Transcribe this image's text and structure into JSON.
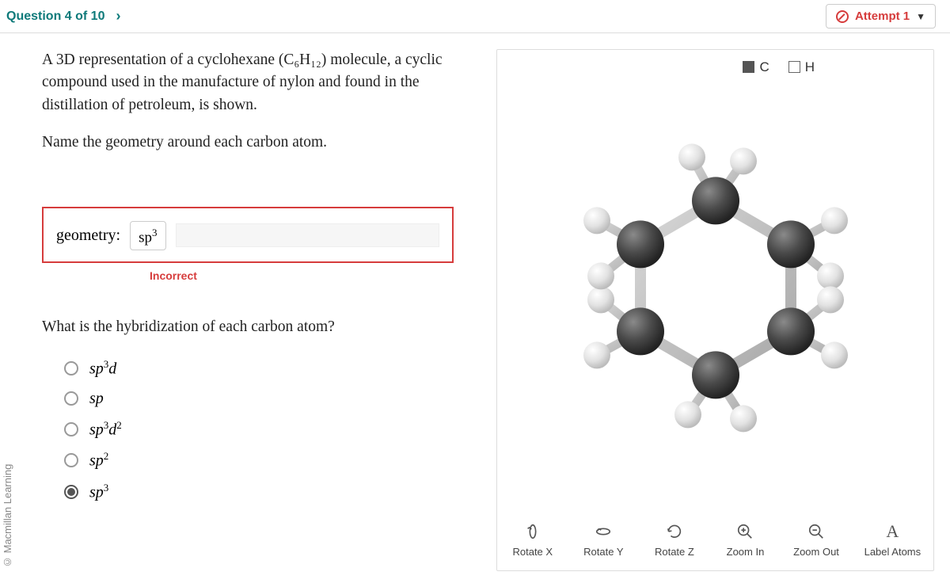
{
  "header": {
    "question_label": "Question 4 of 10",
    "attempt_label": "Attempt 1"
  },
  "watermark": "© Macmillan Learning",
  "prompt_text": "A 3D representation of a cyclohexane (C₆H₁₂) molecule, a cyclic compound used in the manufacture of nylon and found in the distillation of petroleum, is shown.",
  "prompt_text_2": "Name the geometry around each carbon atom.",
  "geometry": {
    "label": "geometry:",
    "value_html": "sp³",
    "feedback": "Incorrect"
  },
  "q2": "What is the hybridization of each carbon atom?",
  "options": [
    {
      "id": "sp3d",
      "label": "sp³d",
      "selected": false
    },
    {
      "id": "sp",
      "label": "sp",
      "selected": false
    },
    {
      "id": "sp3d2",
      "label": "sp³d²",
      "selected": false
    },
    {
      "id": "sp2",
      "label": "sp²",
      "selected": false
    },
    {
      "id": "sp3",
      "label": "sp³",
      "selected": true
    }
  ],
  "legend": {
    "c": "C",
    "h": "H"
  },
  "toolbar": [
    {
      "id": "rotate-x",
      "label": "Rotate X",
      "glyph": "↻"
    },
    {
      "id": "rotate-y",
      "label": "Rotate Y",
      "glyph": "↺"
    },
    {
      "id": "rotate-z",
      "label": "Rotate Z",
      "glyph": "⟲"
    },
    {
      "id": "zoom-in",
      "label": "Zoom In",
      "glyph": "⊕"
    },
    {
      "id": "zoom-out",
      "label": "Zoom Out",
      "glyph": "⊖"
    },
    {
      "id": "label-atoms",
      "label": "Label Atoms",
      "glyph": "A"
    }
  ],
  "colors": {
    "carbon": "#4a4a4a",
    "hydrogen": "#e8e8e8"
  }
}
